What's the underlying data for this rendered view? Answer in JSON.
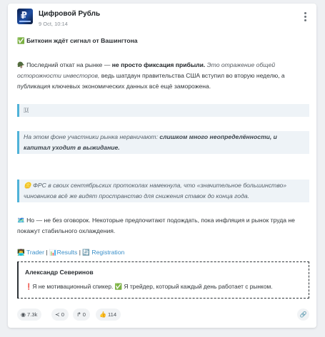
{
  "post": {
    "channel_name": "Цифровой Рубль",
    "date": "9 Oct, 10:14",
    "avatar_icon": "ruble-logo-icon",
    "title": "✅ Биткоин ждёт сигнал от Вашингтона",
    "p1_emoji": "🪖",
    "p1_plain1": " Последний откат на рынке — ",
    "p1_bold": "не просто фиксация прибыли.",
    "p1_italic": " Это отражение общей осторожности инвесторов,",
    "p1_plain2": " ведь шатдаун правительства США вступил во вторую неделю, а публикация ключевых экономических данных всё ещё заморожена.",
    "quote1": "🇺",
    "quote2_plain": "На этом фоне участники рынка нервничают: ",
    "quote2_bold": "слишком много неопределённости, и капитал уходит в выжидание.",
    "quote3": "🪙 ФРС в своих сентябрьских протоколах намекнула, что «значительное большинство» чиновников всё же видят пространство для снижения ставок до конца года.",
    "p2": "🗺️ Но — не без оговорок. Некоторые предпочитают подождать, пока инфляция и рынок труда не покажут стабильного охлаждения.",
    "links": {
      "prefix": "👨‍💻",
      "trader": "Trader",
      "sep": " | ",
      "results_prefix": "📊",
      "results": "Results",
      "reg_prefix": "🔄 ",
      "registration": "Registration"
    },
    "signature": {
      "name": "Александр Северинов",
      "text": "❗Я не мотивационный спикер. ✅ Я трейдер, который каждый день работает с рынком."
    }
  },
  "footer": {
    "views": "7.3k",
    "shares": "0",
    "forwards": "0",
    "reactions": "114",
    "views_icon": "eye-icon",
    "shares_icon": "share-nodes-icon",
    "forwards_icon": "forward-arrow-icon",
    "reactions_icon": "thumbs-up-icon",
    "link_icon": "link-icon"
  }
}
